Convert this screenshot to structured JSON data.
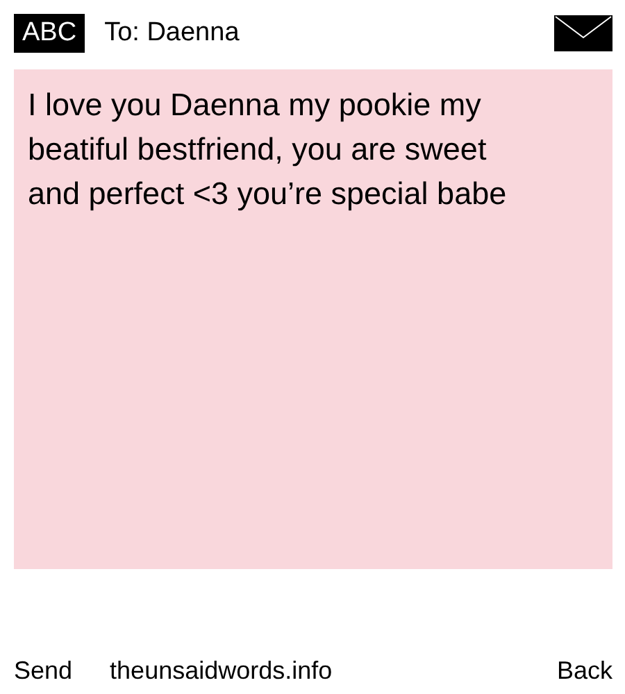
{
  "header": {
    "mode": "ABC",
    "recipient": "To: Daenna"
  },
  "message": {
    "text": "I love you Daenna my pookie my beatiful bestfriend, you are sweet and perfect <3 you’re special babe"
  },
  "footer": {
    "send": "Send",
    "site": "theunsaidwords.info",
    "back": "Back"
  }
}
